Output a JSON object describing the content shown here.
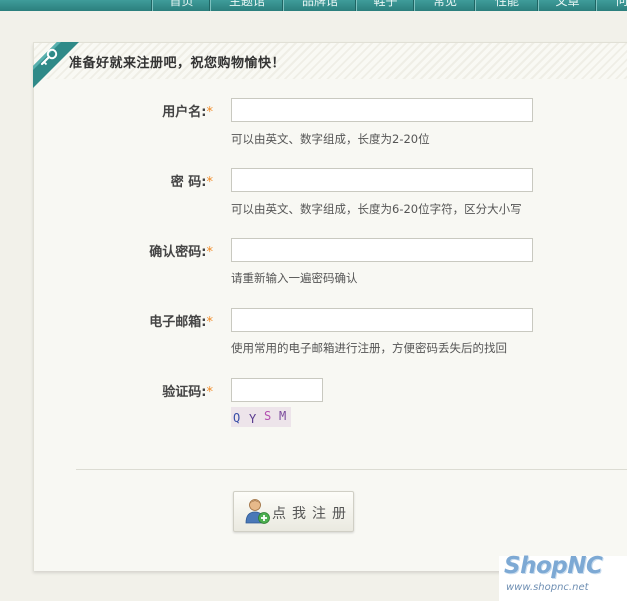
{
  "nav": {
    "tabs": [
      "首页",
      "主题馆",
      "品牌馆",
      "鞋子",
      "常见",
      "性能",
      "文章",
      "问"
    ]
  },
  "form": {
    "title": "准备好就来注册吧，祝您购物愉快！",
    "required_mark": "*",
    "username": {
      "label": "用户名:",
      "value": "",
      "hint": "可以由英文、数字组成，长度为2-20位"
    },
    "password": {
      "label": "密 码:",
      "value": "",
      "hint": "可以由英文、数字组成，长度为6-20位字符，区分大小写"
    },
    "confirm_password": {
      "label": "确认密码:",
      "value": "",
      "hint": "请重新输入一遍密码确认"
    },
    "email": {
      "label": "电子邮箱:",
      "value": "",
      "hint": "使用常用的电子邮箱进行注册，方便密码丢失后的找回"
    },
    "captcha": {
      "label": "验证码:",
      "value": "",
      "image_text": [
        "Q",
        "Y",
        "S",
        "M"
      ]
    },
    "submit_label": "点我注册"
  },
  "logo": {
    "name": "ShopNC",
    "url": "www.shopnc.net"
  },
  "colors": {
    "accent": "#2f8a88",
    "required": "#f08a24",
    "logo": "#7da9d4"
  },
  "icons": {
    "ribbon": "key-icon",
    "submit": "add-user-icon"
  }
}
